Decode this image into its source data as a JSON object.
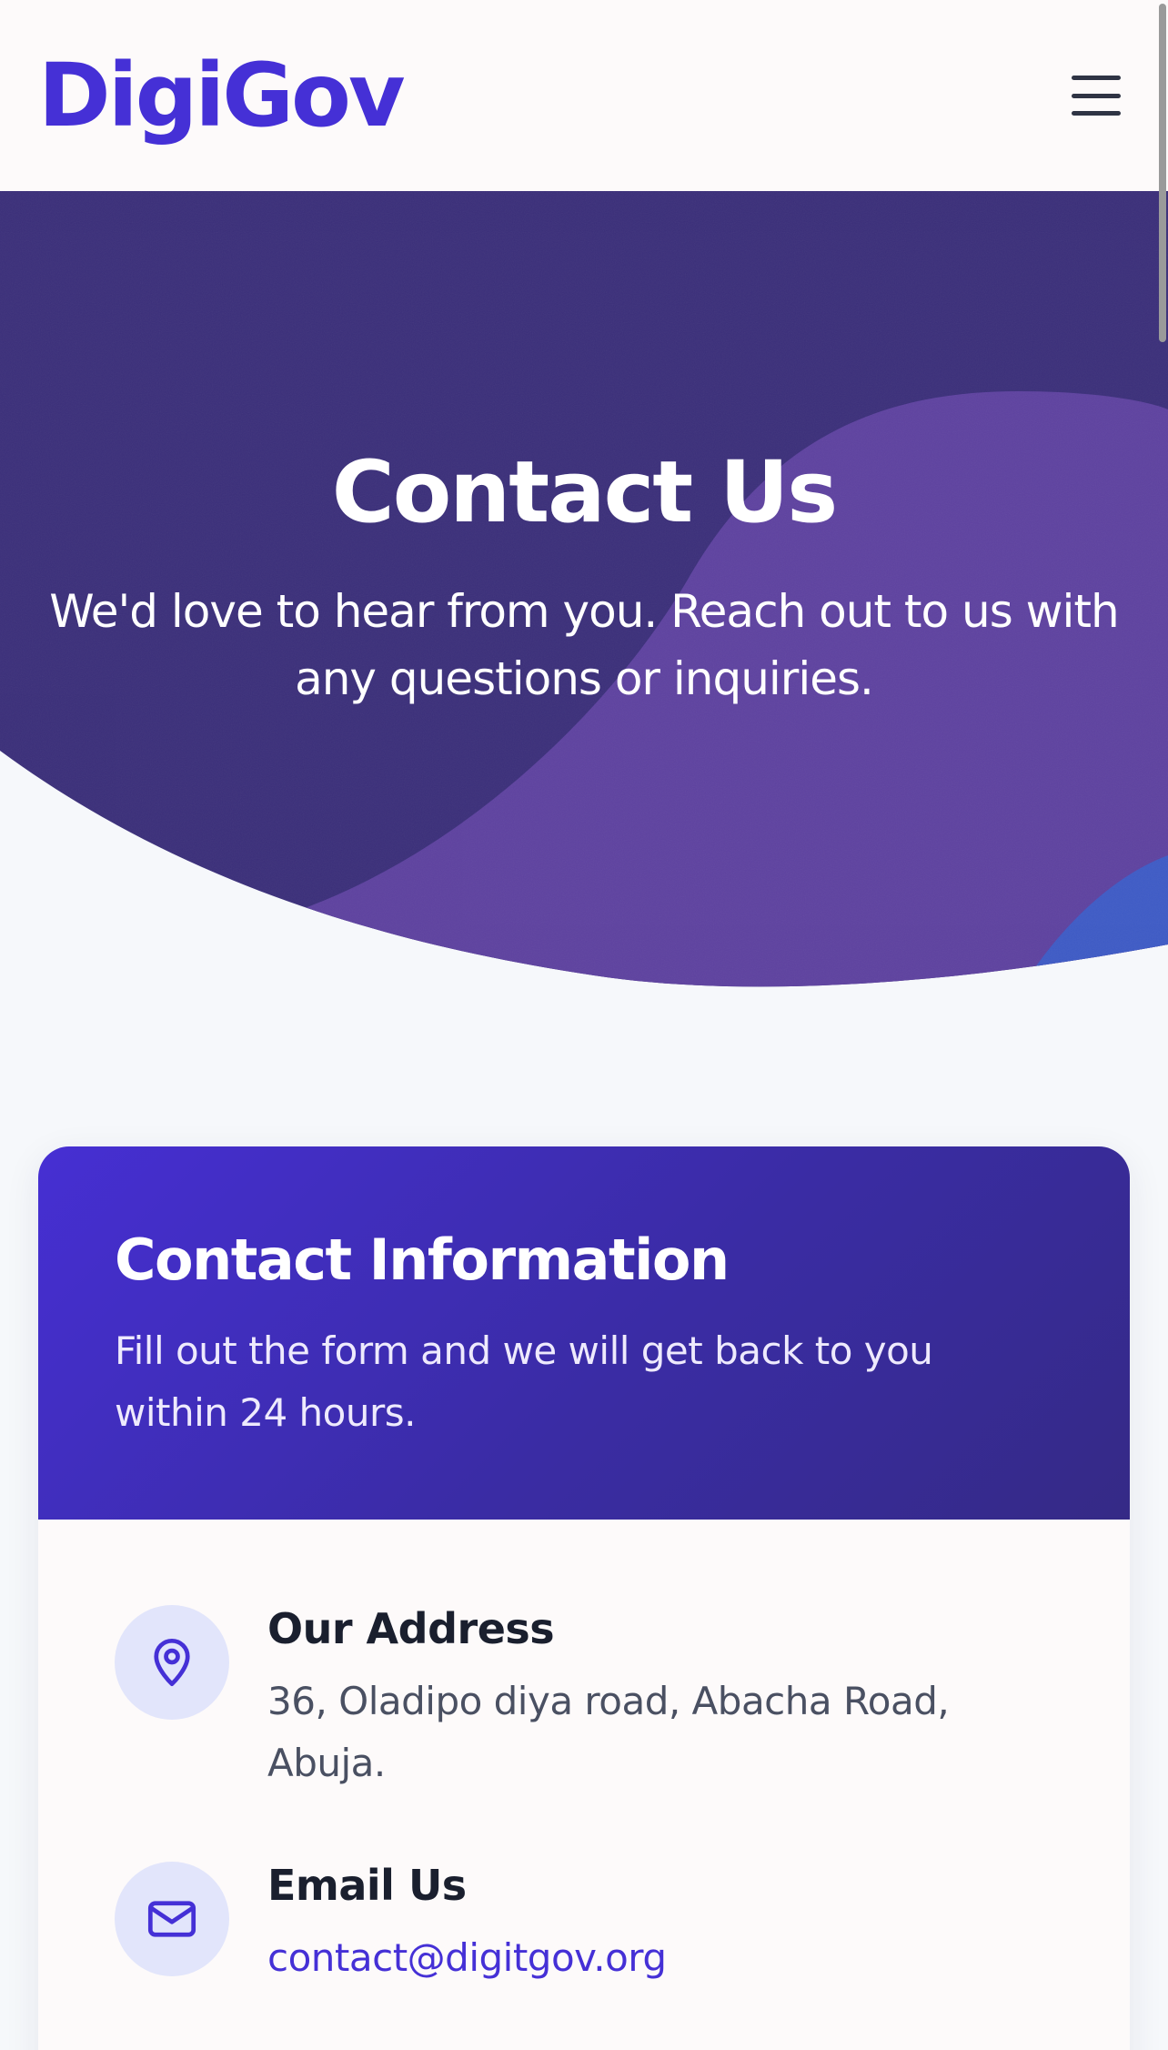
{
  "header": {
    "logo": "DigiGov",
    "menu_icon": "hamburger-menu-icon"
  },
  "hero": {
    "title": "Contact Us",
    "subtitle": "We'd love to hear from you. Reach out to us with any questions or inquiries."
  },
  "contact_card": {
    "title": "Contact Information",
    "description": "Fill out the form and we will get back to you within 24 hours.",
    "items": [
      {
        "icon": "map-pin-icon",
        "title": "Our Address",
        "value": "36, Oladipo diya road, Abacha Road, Abuja."
      },
      {
        "icon": "mail-icon",
        "title": "Email Us",
        "value": "contact@digitgov.org"
      }
    ]
  },
  "colors": {
    "brand": "#4530d6",
    "hero_dark": "#3b2f7a",
    "hero_wave": "#5e42a0",
    "card_gradient_start": "#462fd3",
    "card_gradient_end": "#352a86",
    "icon_circle": "#e2e5fb"
  }
}
